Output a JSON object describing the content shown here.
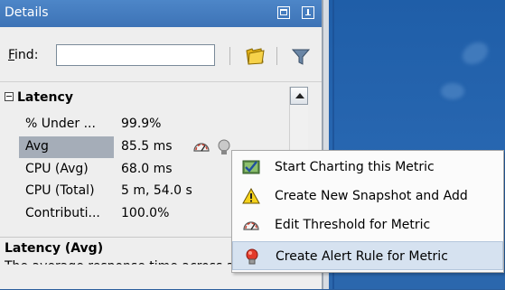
{
  "panel": {
    "title": "Details"
  },
  "find": {
    "label_prefix": "F",
    "label_rest": "ind:",
    "value": "",
    "placeholder": ""
  },
  "tree": {
    "section": "Latency",
    "rows": [
      {
        "name": "% Under ...",
        "value": "99.9%"
      },
      {
        "name": "Avg",
        "value": "85.5 ms"
      },
      {
        "name": "CPU (Avg)",
        "value": "68.0 ms"
      },
      {
        "name": "CPU (Total)",
        "value": "5 m, 54.0 s"
      },
      {
        "name": "Contributi...",
        "value": "100.0%"
      }
    ]
  },
  "description": {
    "title": "Latency (Avg)",
    "text": "The average response time across all"
  },
  "context_menu": {
    "items": [
      {
        "label": "Start Charting this Metric",
        "icon": "chart-check-icon"
      },
      {
        "label": "Create New Snapshot and Add",
        "icon": "warning-icon"
      },
      {
        "label": "Edit Threshold for Metric",
        "icon": "gauge-icon"
      },
      {
        "label": "Create Alert Rule for  Metric",
        "icon": "alert-bulb-icon"
      }
    ]
  },
  "colors": {
    "titlebar": "#4279bd",
    "selection": "#a5adb8",
    "menu_hover": "#d6e2f0",
    "desktop": "#2766b0"
  }
}
